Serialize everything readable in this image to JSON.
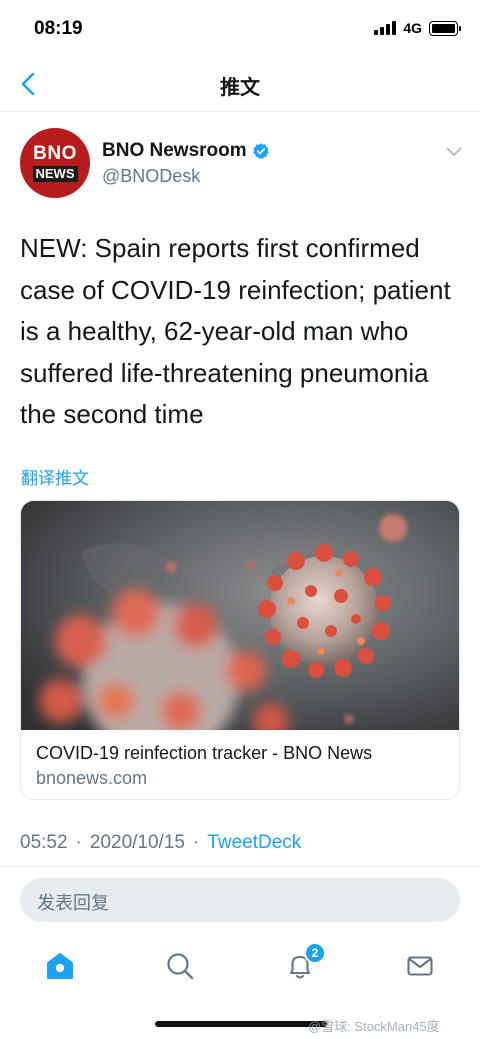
{
  "status_bar": {
    "time": "08:19",
    "network": "4G"
  },
  "header": {
    "title": "推文"
  },
  "author": {
    "avatar_top": "BNO",
    "avatar_bottom": "NEWS",
    "name": "BNO Newsroom",
    "handle": "@BNODesk"
  },
  "tweet": {
    "text": "NEW: Spain reports first confirmed case of COVID-19 reinfection; patient is a healthy, 62-year-old man who suffered life-threatening pneumonia the second time",
    "translate_label": "翻译推文"
  },
  "card": {
    "title": "COVID-19 reinfection tracker - BNO News",
    "domain": "bnonews.com"
  },
  "meta": {
    "time": "05:52",
    "separator": "·",
    "date": "2020/10/15",
    "source": "TweetDeck"
  },
  "reply": {
    "placeholder": "发表回复"
  },
  "tabbar": {
    "notifications_badge": "2"
  },
  "watermark": "@雪球: StockMan45度",
  "colors": {
    "accent": "#1da1f2",
    "secondary_text": "#657786",
    "avatar_red": "#b71c1c"
  },
  "icons": [
    "back-arrow-icon",
    "verified-badge-icon",
    "chevron-down-icon",
    "home-icon",
    "search-icon",
    "bell-icon",
    "mail-icon"
  ]
}
